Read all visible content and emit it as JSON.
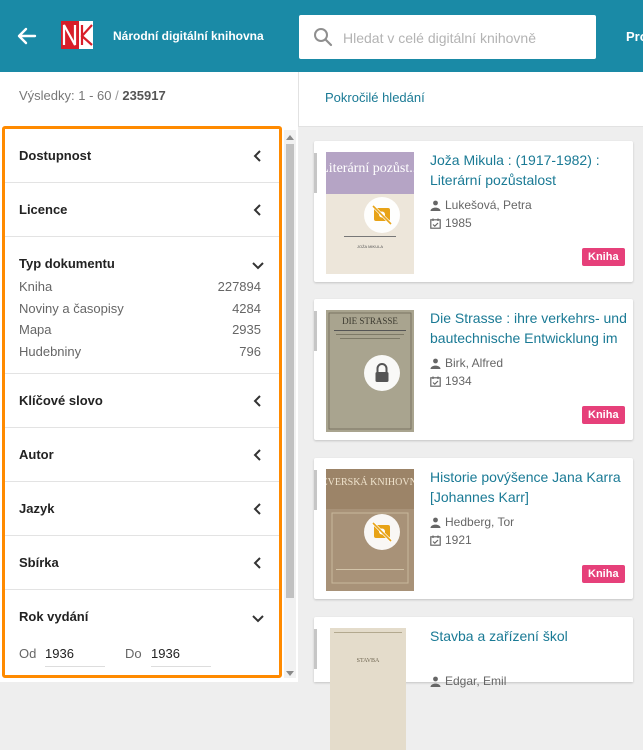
{
  "header": {
    "brand": "Národní digitální knihovna",
    "search_placeholder": "Hledat v celé digitální knihovně",
    "truncated_link": "Pro"
  },
  "subbar": {
    "results_prefix": "Výsledky: 1 - 60",
    "results_sep": " / ",
    "results_total": "235917",
    "advanced_search": "Pokročilé hledání"
  },
  "filters": [
    {
      "title": "Dostupnost"
    },
    {
      "title": "Licence"
    },
    {
      "title": "Typ dokumentu",
      "items": [
        {
          "label": "Kniha",
          "count": "227894"
        },
        {
          "label": "Noviny a časopisy",
          "count": "4284"
        },
        {
          "label": "Mapa",
          "count": "2935"
        },
        {
          "label": "Hudebniny",
          "count": "796"
        }
      ]
    },
    {
      "title": "Klíčové slovo"
    },
    {
      "title": "Autor"
    },
    {
      "title": "Jazyk"
    },
    {
      "title": "Sbírka"
    },
    {
      "title": "Rok vydání",
      "range": {
        "from_label": "Od",
        "from": "1936",
        "to_label": "Do",
        "to": "1936"
      }
    }
  ],
  "results": [
    {
      "title": "Joža Mikula : (1917-1982) : Literární pozůstalost",
      "author": "Lukešová, Petra",
      "year": "1985",
      "type": "Kniha",
      "access_icon": "hidden-icon",
      "cover_text": "Literární pozůst...",
      "cover_small": "JOŽA MIKULA"
    },
    {
      "title": "Die Strasse : ihre verkehrs- und bautechnische Entwicklung im",
      "author": "Birk, Alfred",
      "year": "1934",
      "type": "Kniha",
      "access_icon": "lock-icon",
      "cover_text": "DIE STRASSE"
    },
    {
      "title": "Historie povýšence Jana Karra [Johannes Karr]",
      "author": "Hedberg, Tor",
      "year": "1921",
      "type": "Kniha",
      "access_icon": "hidden-icon",
      "cover_text": "SEVERSKÁ KNIHOVNA"
    },
    {
      "title": "Stavba a zařízení škol",
      "author": "Edgar, Emil",
      "cover_text": "STAVBA"
    }
  ],
  "colors": {
    "header": "#1a8aa6",
    "accent": "#1a7a95",
    "highlight": "#ff8a00",
    "tag": "#e6407a"
  }
}
